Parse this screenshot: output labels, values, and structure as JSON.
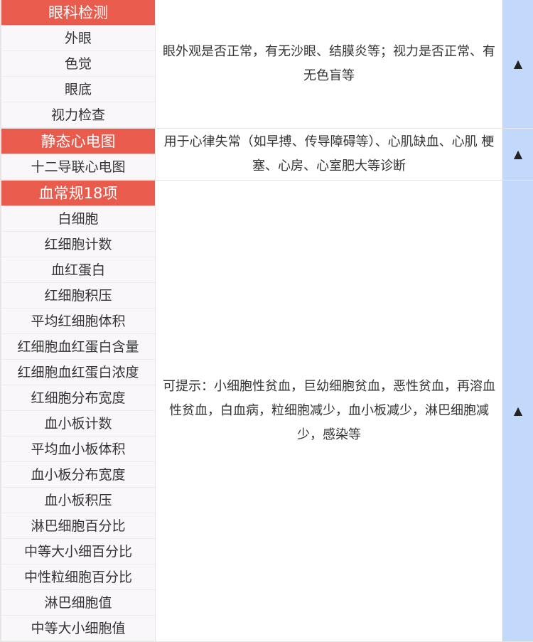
{
  "sections": [
    {
      "title": "眼科检测",
      "items": [
        "外眼",
        "色觉",
        "眼底",
        "视力检查"
      ],
      "description": "眼外观是否正常，有无沙眼、结膜炎等；视力是否正常、有无色盲等",
      "toggle_icon": "▲"
    },
    {
      "title": "静态心电图",
      "items": [
        "十二导联心电图"
      ],
      "description": "用于心律失常（如早搏、传导障碍等）、心肌缺血、心肌 梗塞、心房、心室肥大等诊断",
      "toggle_icon": "▲"
    },
    {
      "title": "血常规18项",
      "items": [
        "白细胞",
        "红细胞计数",
        "血红蛋白",
        "红细胞积压",
        "平均红细胞体积",
        "红细胞血红蛋白含量",
        "红细胞血红蛋白浓度",
        "红细胞分布宽度",
        "血小板计数",
        "平均血小板体积",
        "血小板分布宽度",
        "血小板积压",
        "淋巴细胞百分比",
        "中等大小细百分比",
        "中性粒细胞百分比",
        "淋巴细胞值",
        "中等大小细胞值"
      ],
      "description": "可提示：小细胞性贫血，巨幼细胞贫血，恶性贫血，再溶血性贫血，白血病，粒细胞减少，血小板减少，淋巴细胞减少，感染等",
      "toggle_icon": "▲"
    }
  ],
  "colors": {
    "header_bg": "#e85b4d",
    "item_bg": "#faf7fb",
    "toggle_bg": "#c2d9fb"
  }
}
